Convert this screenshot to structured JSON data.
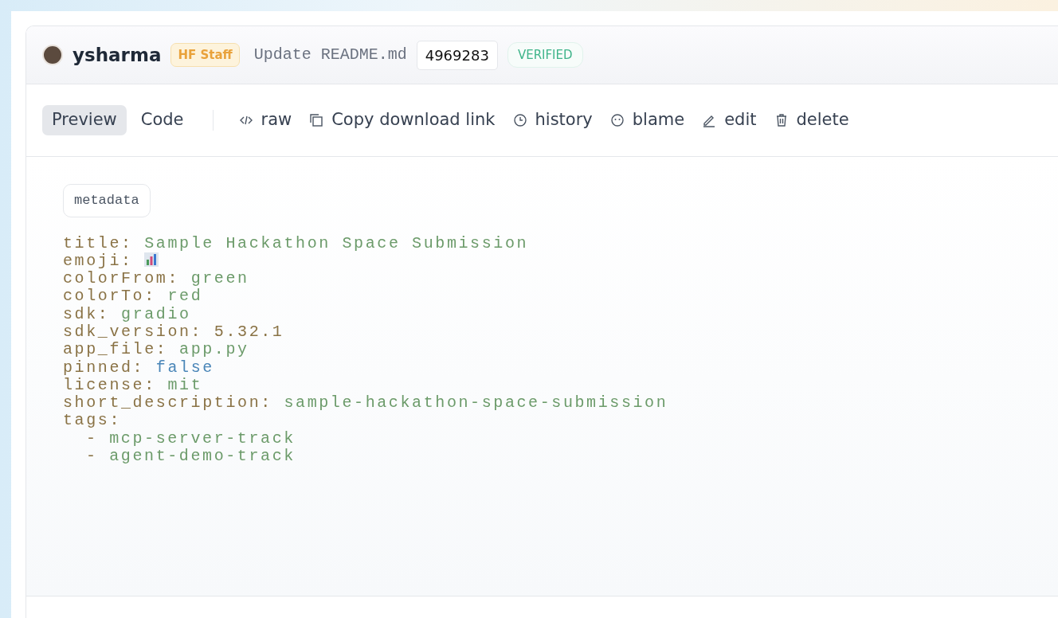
{
  "commit": {
    "author": "ysharma",
    "author_badge": "HF Staff",
    "message": "Update README.md",
    "hash": "4969283",
    "status": "VERIFIED"
  },
  "view_tabs": [
    {
      "label": "Preview",
      "selected": true
    },
    {
      "label": "Code",
      "selected": false
    }
  ],
  "actions": [
    {
      "kind": "raw",
      "label": "raw"
    },
    {
      "kind": "copy",
      "label": "Copy download link"
    },
    {
      "kind": "history",
      "label": "history"
    },
    {
      "kind": "blame",
      "label": "blame"
    },
    {
      "kind": "edit",
      "label": "edit"
    },
    {
      "kind": "delete",
      "label": "delete"
    }
  ],
  "metadata": {
    "label": "metadata",
    "lines": [
      {
        "key": "title:",
        "kind": "string",
        "value": "Sample Hackathon Space Submission"
      },
      {
        "key": "emoji:",
        "kind": "emoji"
      },
      {
        "key": "colorFrom:",
        "kind": "string",
        "value": "green"
      },
      {
        "key": "colorTo:",
        "kind": "string",
        "value": "red"
      },
      {
        "key": "sdk:",
        "kind": "string",
        "value": "gradio"
      },
      {
        "key": "sdk_version:",
        "kind": "number",
        "value": "5.32.1"
      },
      {
        "key": "app_file:",
        "kind": "string",
        "value": "app.py"
      },
      {
        "key": "pinned:",
        "kind": "boolean",
        "value": "false"
      },
      {
        "key": "license:",
        "kind": "string",
        "value": "mit"
      },
      {
        "key": "short_description:",
        "kind": "string",
        "value": "sample-hackathon-space-submission"
      },
      {
        "key": "tags:",
        "kind": "list",
        "children": [
          {
            "dash": "-",
            "value": "mcp-server-track"
          },
          {
            "dash": "-",
            "value": "agent-demo-track"
          }
        ]
      }
    ]
  }
}
